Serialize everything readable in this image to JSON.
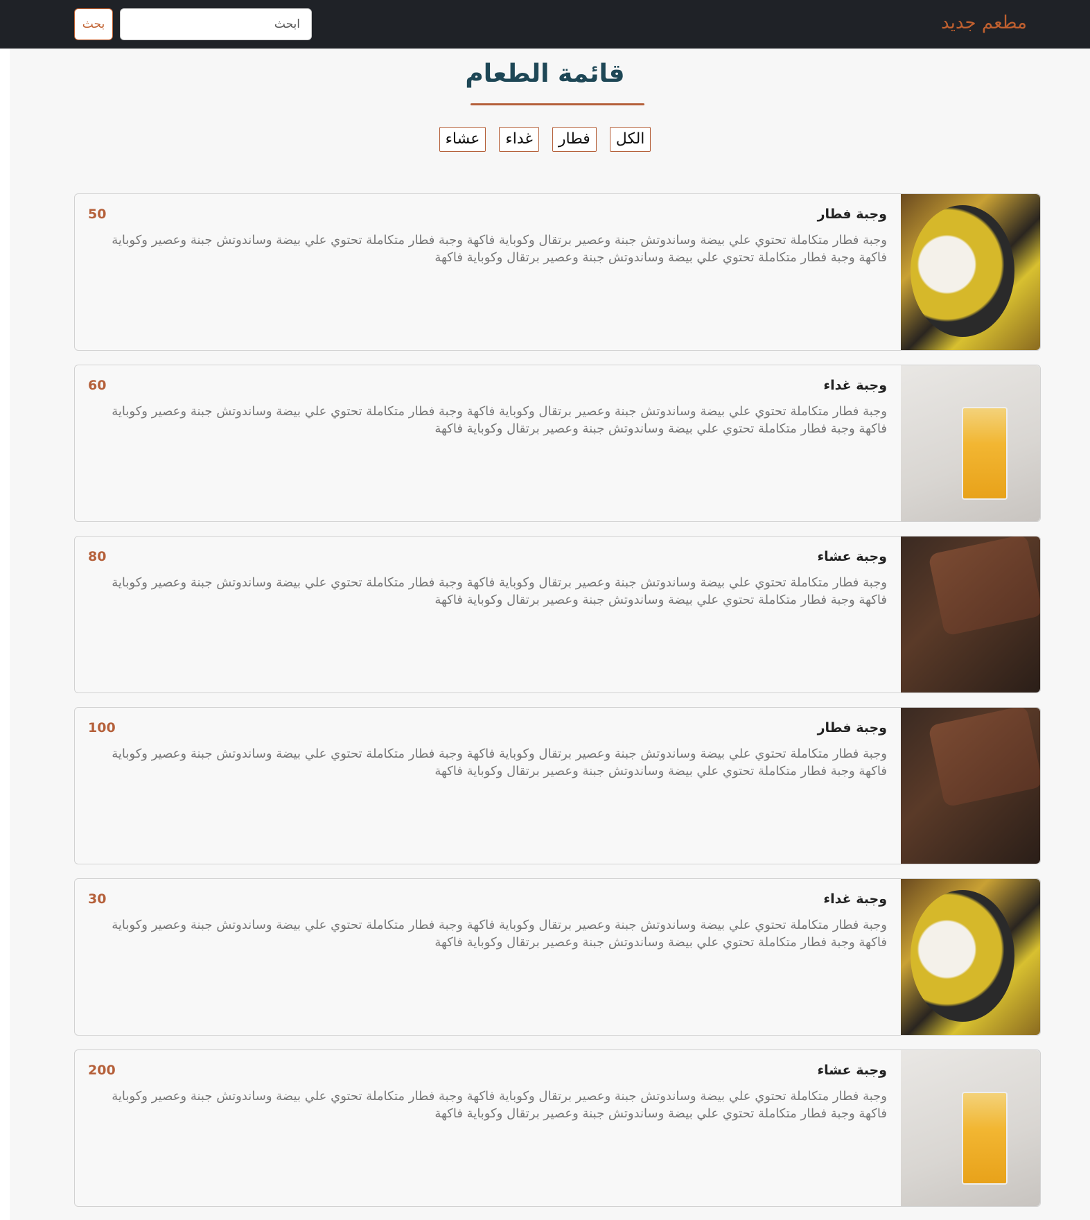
{
  "navbar": {
    "brand": "مطعم جديد",
    "search_placeholder": "ابحث",
    "search_button": "بحث"
  },
  "menu": {
    "title": "قائمة الطعام",
    "filters": [
      "الكل",
      "فطار",
      "غداء",
      "عشاء"
    ]
  },
  "items": [
    {
      "title": "وجبة فطار",
      "price": "50",
      "image": "breakfast-plate",
      "description": "وجبة فطار متكاملة تحتوي علي بيضة وساندوتش جبنة وعصير برتقال وكوباية فاكهة وجبة فطار متكاملة تحتوي علي بيضة وساندوتش جبنة وعصير وكوباية فاكهة وجبة فطار متكاملة تحتوي علي بيضة وساندوتش جبنة وعصير برتقال وكوباية فاكهة"
    },
    {
      "title": "وجبة غداء",
      "price": "60",
      "image": "juice-glass",
      "description": "وجبة فطار متكاملة تحتوي علي بيضة وساندوتش جبنة وعصير برتقال وكوباية فاكهة وجبة فطار متكاملة تحتوي علي بيضة وساندوتش جبنة وعصير وكوباية فاكهة وجبة فطار متكاملة تحتوي علي بيضة وساندوتش جبنة وعصير برتقال وكوباية فاكهة"
    },
    {
      "title": "وجبة عشاء",
      "price": "80",
      "image": "chocolate-cake",
      "description": "وجبة فطار متكاملة تحتوي علي بيضة وساندوتش جبنة وعصير برتقال وكوباية فاكهة وجبة فطار متكاملة تحتوي علي بيضة وساندوتش جبنة وعصير وكوباية فاكهة وجبة فطار متكاملة تحتوي علي بيضة وساندوتش جبنة وعصير برتقال وكوباية فاكهة"
    },
    {
      "title": "وجبة فطار",
      "price": "100",
      "image": "chocolate-cake",
      "description": "وجبة فطار متكاملة تحتوي علي بيضة وساندوتش جبنة وعصير برتقال وكوباية فاكهة وجبة فطار متكاملة تحتوي علي بيضة وساندوتش جبنة وعصير وكوباية فاكهة وجبة فطار متكاملة تحتوي علي بيضة وساندوتش جبنة وعصير برتقال وكوباية فاكهة"
    },
    {
      "title": "وجبة غداء",
      "price": "30",
      "image": "breakfast-plate",
      "description": "وجبة فطار متكاملة تحتوي علي بيضة وساندوتش جبنة وعصير برتقال وكوباية فاكهة وجبة فطار متكاملة تحتوي علي بيضة وساندوتش جبنة وعصير وكوباية فاكهة وجبة فطار متكاملة تحتوي علي بيضة وساندوتش جبنة وعصير برتقال وكوباية فاكهة"
    },
    {
      "title": "وجبة عشاء",
      "price": "200",
      "image": "juice-glass",
      "description": "وجبة فطار متكاملة تحتوي علي بيضة وساندوتش جبنة وعصير برتقال وكوباية فاكهة وجبة فطار متكاملة تحتوي علي بيضة وساندوتش جبنة وعصير وكوباية فاكهة وجبة فطار متكاملة تحتوي علي بيضة وساندوتش جبنة وعصير برتقال وكوباية فاكهة"
    }
  ],
  "colors": {
    "navbar_bg": "#1f2227",
    "brand": "#c0602f",
    "accent": "#b5603a",
    "title": "#1e4756"
  }
}
